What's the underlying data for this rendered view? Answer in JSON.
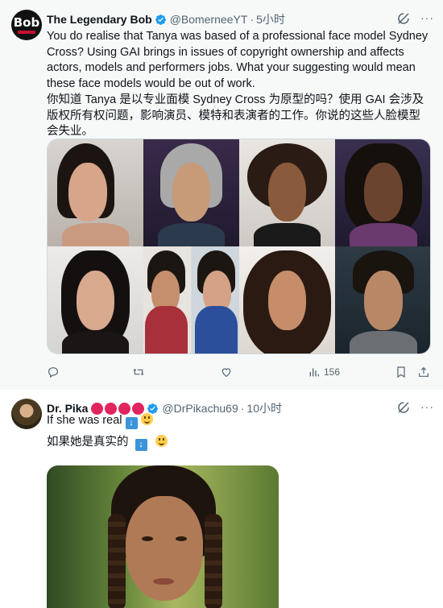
{
  "tweets": [
    {
      "author_name": "The Legendary Bob",
      "avatar_text": "Bob",
      "handle": "@BomerneeYT",
      "separator": "·",
      "time": "5小时",
      "text_en": "You do realise that Tanya was based of a professional face model Sydney Cross? Using GAI brings in issues of copyright ownership and affects actors, models and performers jobs. What your suggesting would mean these face models would be out of work.",
      "text_zh": "你知道 Tanya 是以专业面模 Sydney Cross 为原型的吗？使用 GAI 会涉及版权所有权问题，影响演员、模特和表演者的工作。你说的这些人脸模型会失业。",
      "views": "156"
    },
    {
      "author_name": "Dr. Pika",
      "handle": "@DrPikachu69",
      "separator": "·",
      "time": "10小时",
      "text_en": "If she was real",
      "text_zh": "如果她是真实的"
    }
  ],
  "more_glyph": "···",
  "colors": {
    "accent": "#1d9bf0",
    "muted": "#536471",
    "hover_bg": "#f7f9f9",
    "dot_red": "#e0245e"
  },
  "icons": [
    "verified-badge-icon",
    "grok-icon",
    "more-icon",
    "reply-icon",
    "retweet-icon",
    "like-icon",
    "views-icon",
    "bookmark-icon",
    "share-icon",
    "down-arrow-emoji-icon",
    "smile-emoji-icon"
  ]
}
